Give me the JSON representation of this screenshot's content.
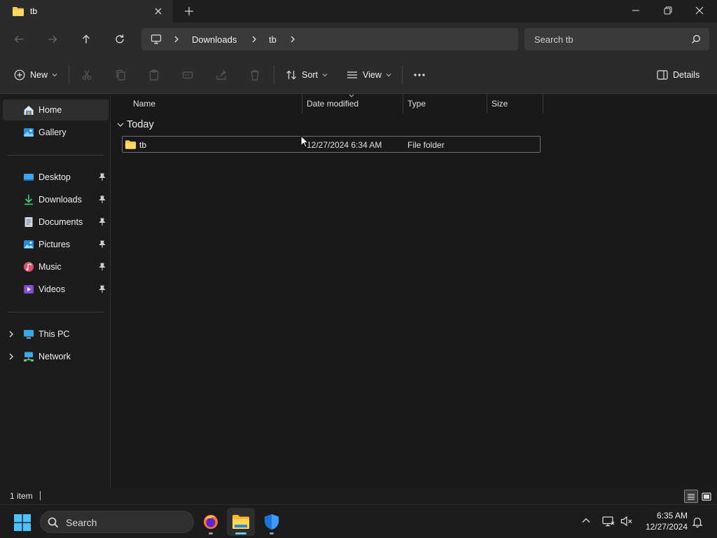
{
  "window": {
    "tab_title": "tb",
    "new_tab_symbol": "+"
  },
  "nav": {
    "breadcrumbs": [
      "Downloads",
      "tb"
    ],
    "search_placeholder": "Search tb"
  },
  "command_bar": {
    "new_label": "New",
    "sort_label": "Sort",
    "view_label": "View",
    "more_label": "...",
    "details_label": "Details",
    "disabled_actions": [
      "cut-icon",
      "copy-icon",
      "paste-icon",
      "rename-icon",
      "share-icon",
      "delete-icon"
    ]
  },
  "sidebar": {
    "top": [
      {
        "label": "Home",
        "icon": "home-icon"
      },
      {
        "label": "Gallery",
        "icon": "gallery-icon"
      }
    ],
    "quick_access": [
      {
        "label": "Desktop",
        "icon": "desktop-icon"
      },
      {
        "label": "Downloads",
        "icon": "downloads-icon"
      },
      {
        "label": "Documents",
        "icon": "documents-icon"
      },
      {
        "label": "Pictures",
        "icon": "pictures-icon"
      },
      {
        "label": "Music",
        "icon": "music-icon"
      },
      {
        "label": "Videos",
        "icon": "videos-icon"
      }
    ],
    "bottom": [
      {
        "label": "This PC",
        "icon": "this-pc-icon"
      },
      {
        "label": "Network",
        "icon": "network-icon"
      }
    ]
  },
  "content": {
    "columns": [
      "Name",
      "Date modified",
      "Type",
      "Size"
    ],
    "group": "Today",
    "rows": [
      {
        "name": "tb",
        "date_modified": "12/27/2024 6:34 AM",
        "type": "File folder",
        "size": ""
      }
    ]
  },
  "status": {
    "item_count": "1 item"
  },
  "taskbar": {
    "search_label": "Search",
    "apps": [
      "firefox-icon",
      "file-explorer-icon",
      "windows-security-icon"
    ],
    "time": "6:35 AM",
    "date": "12/27/2024"
  },
  "colors": {
    "accent": "#60cdff",
    "folder": "#f7c948",
    "background": "#191919"
  }
}
